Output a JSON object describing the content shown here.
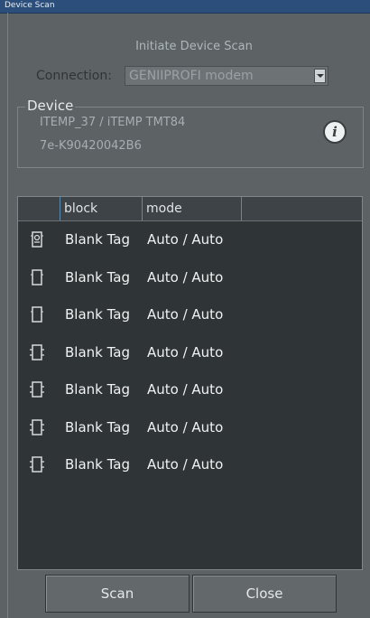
{
  "window": {
    "title": "Device Scan"
  },
  "heading": "Initiate Device Scan",
  "connection": {
    "label": "Connection:",
    "value": "GENIIPROFI modem"
  },
  "device": {
    "legend": "Device",
    "line1": "ITEMP_37 / iTEMP TMT84",
    "line2": "7e-K90420042B6",
    "info_icon": "info-icon"
  },
  "table": {
    "columns": [
      "",
      "block",
      "mode",
      ""
    ],
    "rows": [
      {
        "icon": "device-selected-icon",
        "block": "Blank Tag",
        "mode": "Auto / Auto"
      },
      {
        "icon": "device-icon",
        "block": "Blank Tag",
        "mode": "Auto / Auto"
      },
      {
        "icon": "device-icon",
        "block": "Blank Tag",
        "mode": "Auto / Auto"
      },
      {
        "icon": "device-connected-icon",
        "block": "Blank Tag",
        "mode": "Auto / Auto"
      },
      {
        "icon": "device-connected-icon",
        "block": "Blank Tag",
        "mode": "Auto / Auto"
      },
      {
        "icon": "device-connected-icon",
        "block": "Blank Tag",
        "mode": "Auto / Auto"
      },
      {
        "icon": "device-connected-icon",
        "block": "Blank Tag",
        "mode": "Auto / Auto"
      }
    ]
  },
  "buttons": {
    "scan": "Scan",
    "close": "Close"
  }
}
